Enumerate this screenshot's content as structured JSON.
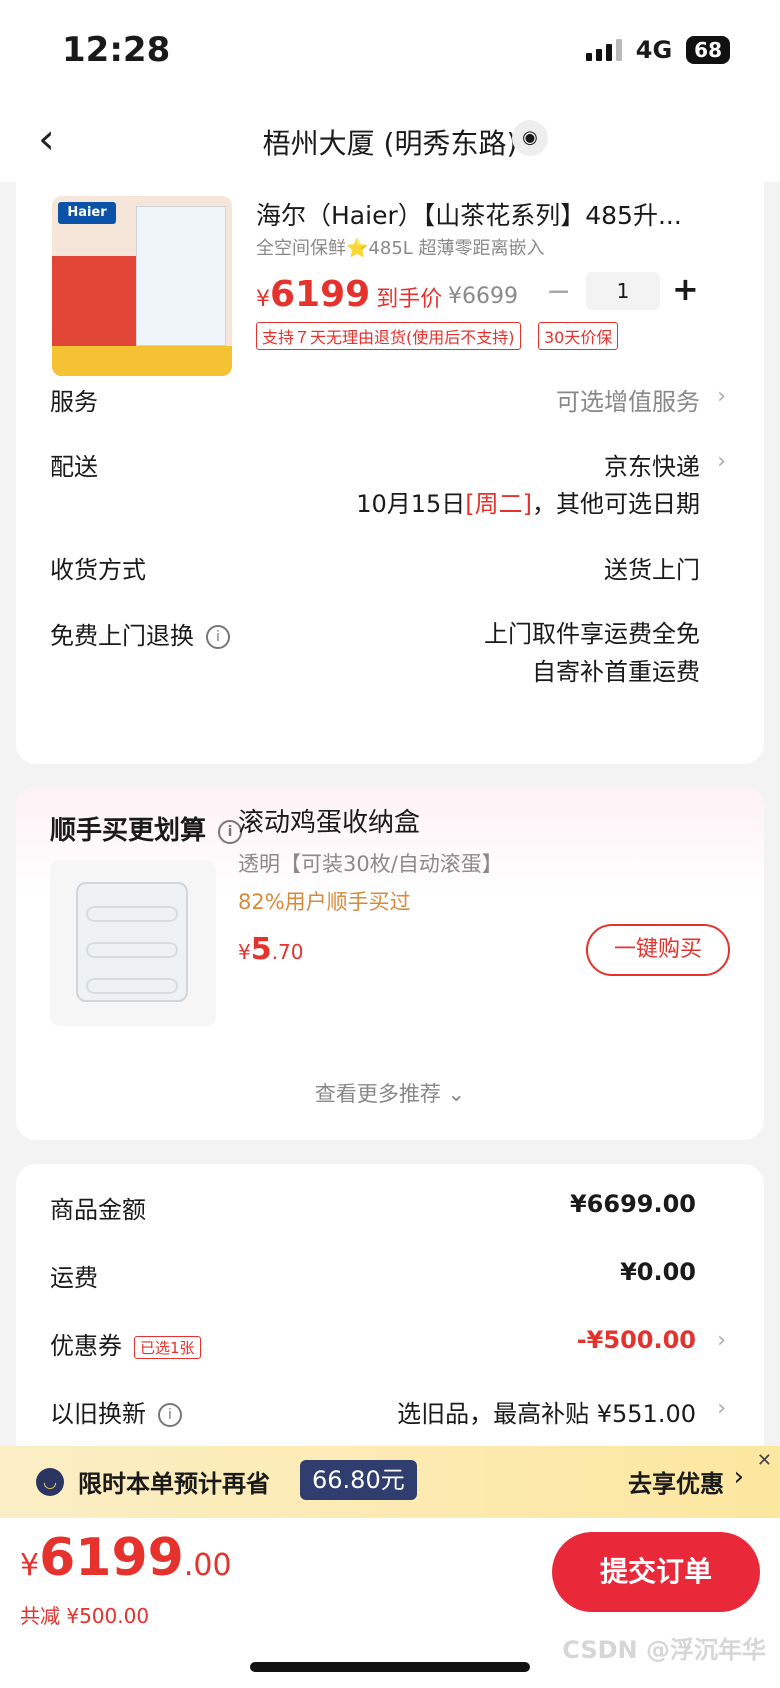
{
  "status_bar": {
    "time": "12:28",
    "network": "4G",
    "battery": "68"
  },
  "nav": {
    "title": "梧州大厦 (明秀东路)"
  },
  "product": {
    "logo": "Haier",
    "title": "海尔（Haier）【山茶花系列】485升...",
    "subtitle": "全空间保鲜⭐485L 超薄零距离嵌入",
    "price_symbol": "¥",
    "price": "6199",
    "price_tag": "到手价",
    "original_price": "¥6699",
    "quantity": "1",
    "badges": [
      "支持７天无理由退货(使用后不支持)",
      "30天价保"
    ]
  },
  "rows": {
    "service": {
      "label": "服务",
      "value": "可选增值服务"
    },
    "delivery": {
      "label": "配送",
      "value": "京东快递",
      "date": "10月15日",
      "weekday": "[周二]",
      "date_suffix": "，其他可选日期"
    },
    "receive": {
      "label": "收货方式",
      "value": "送货上门"
    },
    "return": {
      "label": "免费上门退换",
      "line1": "上门取件享运费全免",
      "line2": "自寄补首重运费"
    }
  },
  "addon": {
    "title": "顺手买更划算",
    "item_title": "滚动鸡蛋收纳盒",
    "item_sub": "透明【可装30枚/自动滚蛋】",
    "item_stat": "82%用户顺手买过",
    "price_symbol": "¥",
    "price_int": "5",
    "price_dec": ".70",
    "buy_label": "一键购买",
    "more_label": "查看更多推荐 ⌄"
  },
  "summary": {
    "goods_label": "商品金额",
    "goods_value": "¥6699.00",
    "freight_label": "运费",
    "freight_value": "¥0.00",
    "coupon_label": "优惠券",
    "coupon_tag": "已选1张",
    "coupon_value": "-¥500.00",
    "tradein_label": "以旧换新",
    "tradein_value": "选旧品，最高补贴 ¥551.00"
  },
  "promo": {
    "text": "限时本单预计再省",
    "amount": "66.80元",
    "action": "去享优惠"
  },
  "bottom": {
    "price_symbol": "¥",
    "price_int": "6199",
    "price_dec": ".00",
    "saved": "共减 ¥500.00",
    "submit": "提交订单",
    "watermark": "CSDN @浮沉年华"
  },
  "colors": {
    "accent": "#e5322d",
    "submit_bg": "#e9283a",
    "promo_bg": "#fce79f",
    "promo_amount_bg": "#2f3e6e"
  }
}
